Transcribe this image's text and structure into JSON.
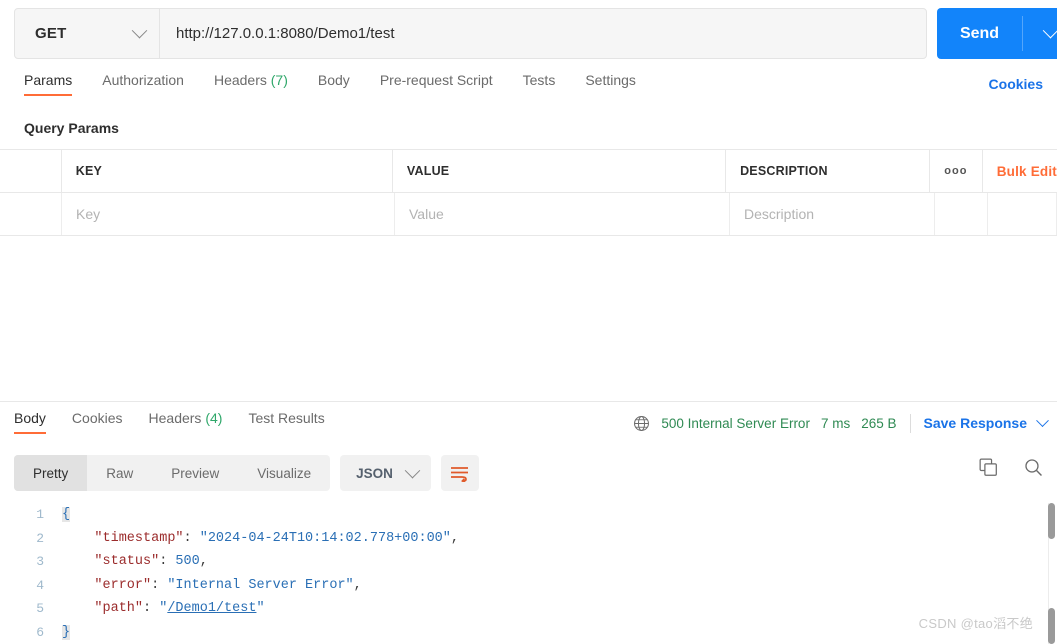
{
  "request": {
    "method": "GET",
    "url": "http://127.0.0.1:8080/Demo1/test",
    "send_label": "Send",
    "cookies_label": "Cookies",
    "tabs": [
      {
        "label": "Params",
        "active": true
      },
      {
        "label": "Authorization",
        "active": false
      },
      {
        "label": "Headers",
        "count": "(7)",
        "active": false
      },
      {
        "label": "Body",
        "active": false
      },
      {
        "label": "Pre-request Script",
        "active": false
      },
      {
        "label": "Tests",
        "active": false
      },
      {
        "label": "Settings",
        "active": false
      }
    ]
  },
  "query_params": {
    "title": "Query Params",
    "columns": [
      "KEY",
      "VALUE",
      "DESCRIPTION"
    ],
    "menu_icon": "ooo",
    "bulk_edit_label": "Bulk Edit",
    "rows": [
      {
        "key_placeholder": "Key",
        "value_placeholder": "Value",
        "description_placeholder": "Description"
      }
    ]
  },
  "response": {
    "tabs": [
      {
        "label": "Body",
        "active": true
      },
      {
        "label": "Cookies",
        "active": false
      },
      {
        "label": "Headers",
        "count": "(4)",
        "active": false
      },
      {
        "label": "Test Results",
        "active": false
      }
    ],
    "status": {
      "code_text": "500 Internal Server Error",
      "time": "7 ms",
      "size": "265 B",
      "color": "#2f8a53"
    },
    "save_response_label": "Save Response",
    "view_modes": [
      {
        "label": "Pretty",
        "active": true
      },
      {
        "label": "Raw",
        "active": false
      },
      {
        "label": "Preview",
        "active": false
      },
      {
        "label": "Visualize",
        "active": false
      }
    ],
    "format": "JSON",
    "body_lines": [
      {
        "n": "1",
        "tokens": [
          {
            "t": "{",
            "c": "brace"
          }
        ]
      },
      {
        "n": "2",
        "tokens": [
          {
            "t": "    ",
            "c": "p"
          },
          {
            "t": "\"timestamp\"",
            "c": "k"
          },
          {
            "t": ": ",
            "c": "p"
          },
          {
            "t": "\"2024-04-24T10:14:02.778+00:00\"",
            "c": "s"
          },
          {
            "t": ",",
            "c": "p"
          }
        ]
      },
      {
        "n": "3",
        "tokens": [
          {
            "t": "    ",
            "c": "p"
          },
          {
            "t": "\"status\"",
            "c": "k"
          },
          {
            "t": ": ",
            "c": "p"
          },
          {
            "t": "500",
            "c": "n"
          },
          {
            "t": ",",
            "c": "p"
          }
        ]
      },
      {
        "n": "4",
        "tokens": [
          {
            "t": "    ",
            "c": "p"
          },
          {
            "t": "\"error\"",
            "c": "k"
          },
          {
            "t": ": ",
            "c": "p"
          },
          {
            "t": "\"Internal Server Error\"",
            "c": "s"
          },
          {
            "t": ",",
            "c": "p"
          }
        ]
      },
      {
        "n": "5",
        "tokens": [
          {
            "t": "    ",
            "c": "p"
          },
          {
            "t": "\"path\"",
            "c": "k"
          },
          {
            "t": ": ",
            "c": "p"
          },
          {
            "t": "\"",
            "c": "s"
          },
          {
            "t": "/Demo1/test",
            "c": "lnk"
          },
          {
            "t": "\"",
            "c": "s"
          }
        ]
      },
      {
        "n": "6",
        "tokens": [
          {
            "t": "}",
            "c": "brace"
          }
        ]
      }
    ]
  },
  "watermark": "CSDN @tao滔不绝",
  "colors": {
    "accent_orange": "#ff6c37",
    "send_blue": "#1284fa",
    "link_blue": "#1a73e8",
    "status_green": "#2f8a53"
  }
}
